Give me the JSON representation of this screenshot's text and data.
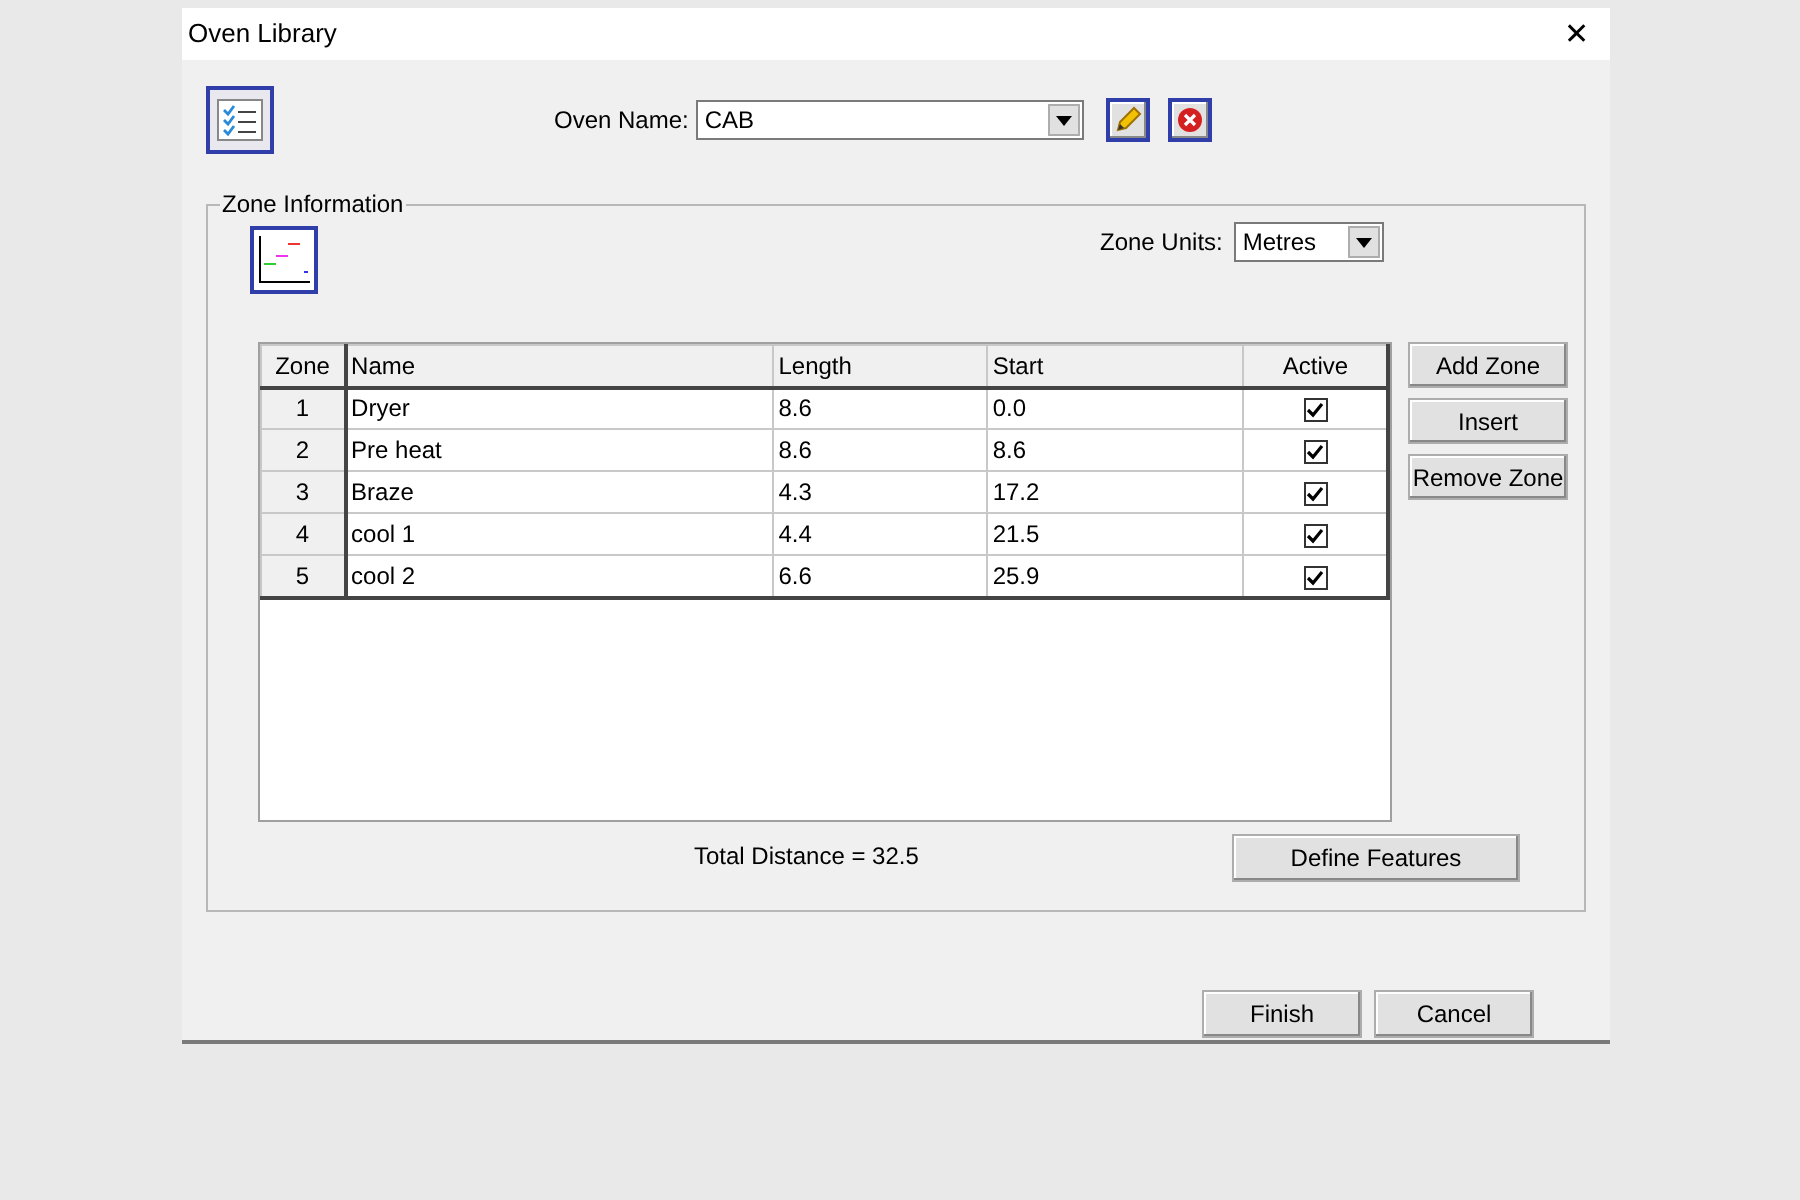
{
  "window": {
    "title": "Oven Library",
    "close": "✕"
  },
  "oven_name": {
    "label": "Oven Name:",
    "value": "CAB"
  },
  "zone_information": {
    "title": "Zone Information",
    "zone_units": {
      "label": "Zone Units:",
      "value": "Metres"
    },
    "table": {
      "columns": [
        "Zone",
        "Name",
        "Length",
        "Start",
        "Active"
      ],
      "rows": [
        {
          "zone": "1",
          "name": "Dryer",
          "length": "8.6",
          "start": "0.0",
          "active": true
        },
        {
          "zone": "2",
          "name": "Pre heat",
          "length": "8.6",
          "start": "8.6",
          "active": true
        },
        {
          "zone": "3",
          "name": "Braze",
          "length": "4.3",
          "start": "17.2",
          "active": true
        },
        {
          "zone": "4",
          "name": "cool 1",
          "length": "4.4",
          "start": "21.5",
          "active": true
        },
        {
          "zone": "5",
          "name": "cool 2",
          "length": "6.6",
          "start": "25.9",
          "active": true
        }
      ]
    },
    "side_buttons": [
      "Add Zone",
      "Insert",
      "Remove Zone"
    ],
    "total": "Total Distance = 32.5",
    "define_button": "Define Features"
  },
  "buttons": [
    "Finish",
    "Cancel"
  ]
}
